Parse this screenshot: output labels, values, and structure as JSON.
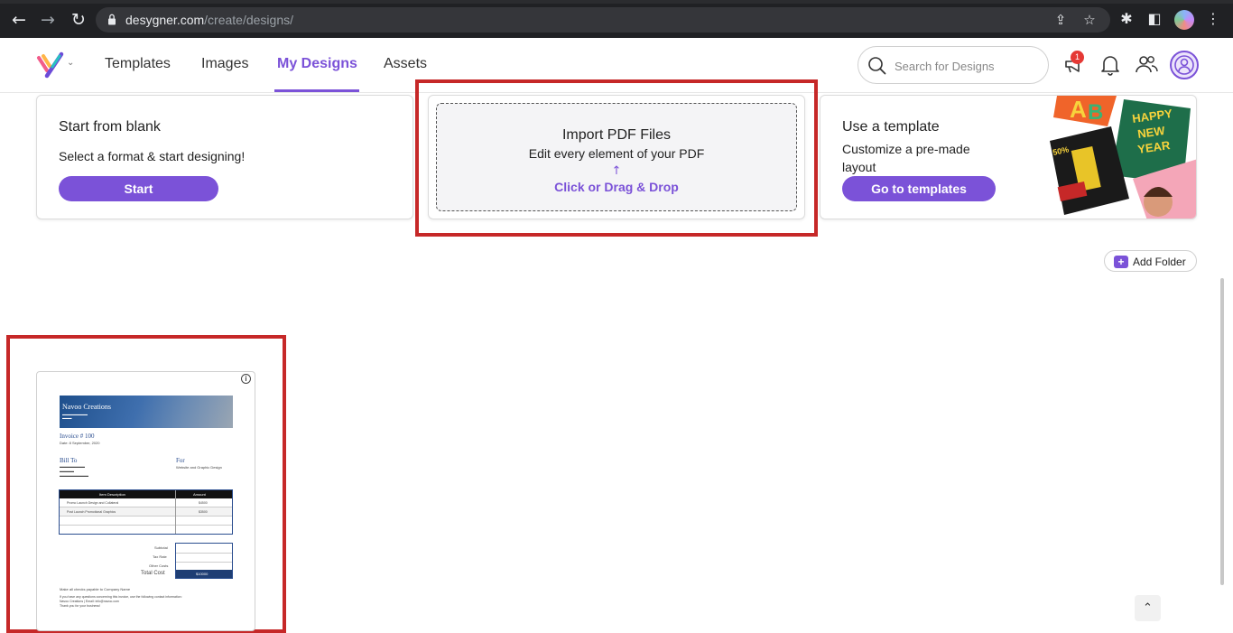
{
  "browser": {
    "url_domain": "desygner.com",
    "url_path": "/create/designs/"
  },
  "nav": {
    "links": [
      "Templates",
      "Images",
      "My Designs",
      "Assets"
    ],
    "active": "My Designs"
  },
  "search": {
    "placeholder": "Search for Designs"
  },
  "notifications": {
    "badge_count": "1"
  },
  "cards": {
    "blank": {
      "title": "Start from blank",
      "subtitle": "Select a format & start designing!",
      "button": "Start"
    },
    "import": {
      "title": "Import PDF Files",
      "subtitle": "Edit every element of your PDF",
      "action": "Click or Drag & Drop"
    },
    "template": {
      "title": "Use a template",
      "subtitle": "Customize a pre-made layout",
      "button": "Go to templates",
      "art_text": [
        "HAPPY",
        "NEW",
        "YEAR",
        "50%"
      ]
    }
  },
  "add_folder": {
    "label": "Add Folder"
  },
  "design_thumbnail": {
    "company": "Navoo Creations",
    "invoice_title": "Invoice # 100",
    "invoice_date": "Date: 8 September, 2020",
    "bill_to_label": "Bill To",
    "for_label": "For",
    "for_value": "Website and Graphic Design",
    "table_headers": [
      "Item Description",
      "Amount"
    ],
    "rows": [
      [
        "Promo Launch Design and Collateral",
        "$4500"
      ],
      [
        "Post Launch Promotional Graphics",
        "$3500"
      ]
    ],
    "totals": [
      "Subtotal",
      "Tax Rate",
      "Other Costs",
      "Total Cost"
    ],
    "total_cost_value": "$10000",
    "footer": [
      "Make all checks payable to Company Name",
      "If you have any questions concerning this invoice, use the following contact information:",
      "Navoo Creations | Email: info@navoo.com",
      "Thank you for your business!"
    ]
  },
  "colors": {
    "accent": "#7b52d8",
    "highlight": "#c62828"
  }
}
